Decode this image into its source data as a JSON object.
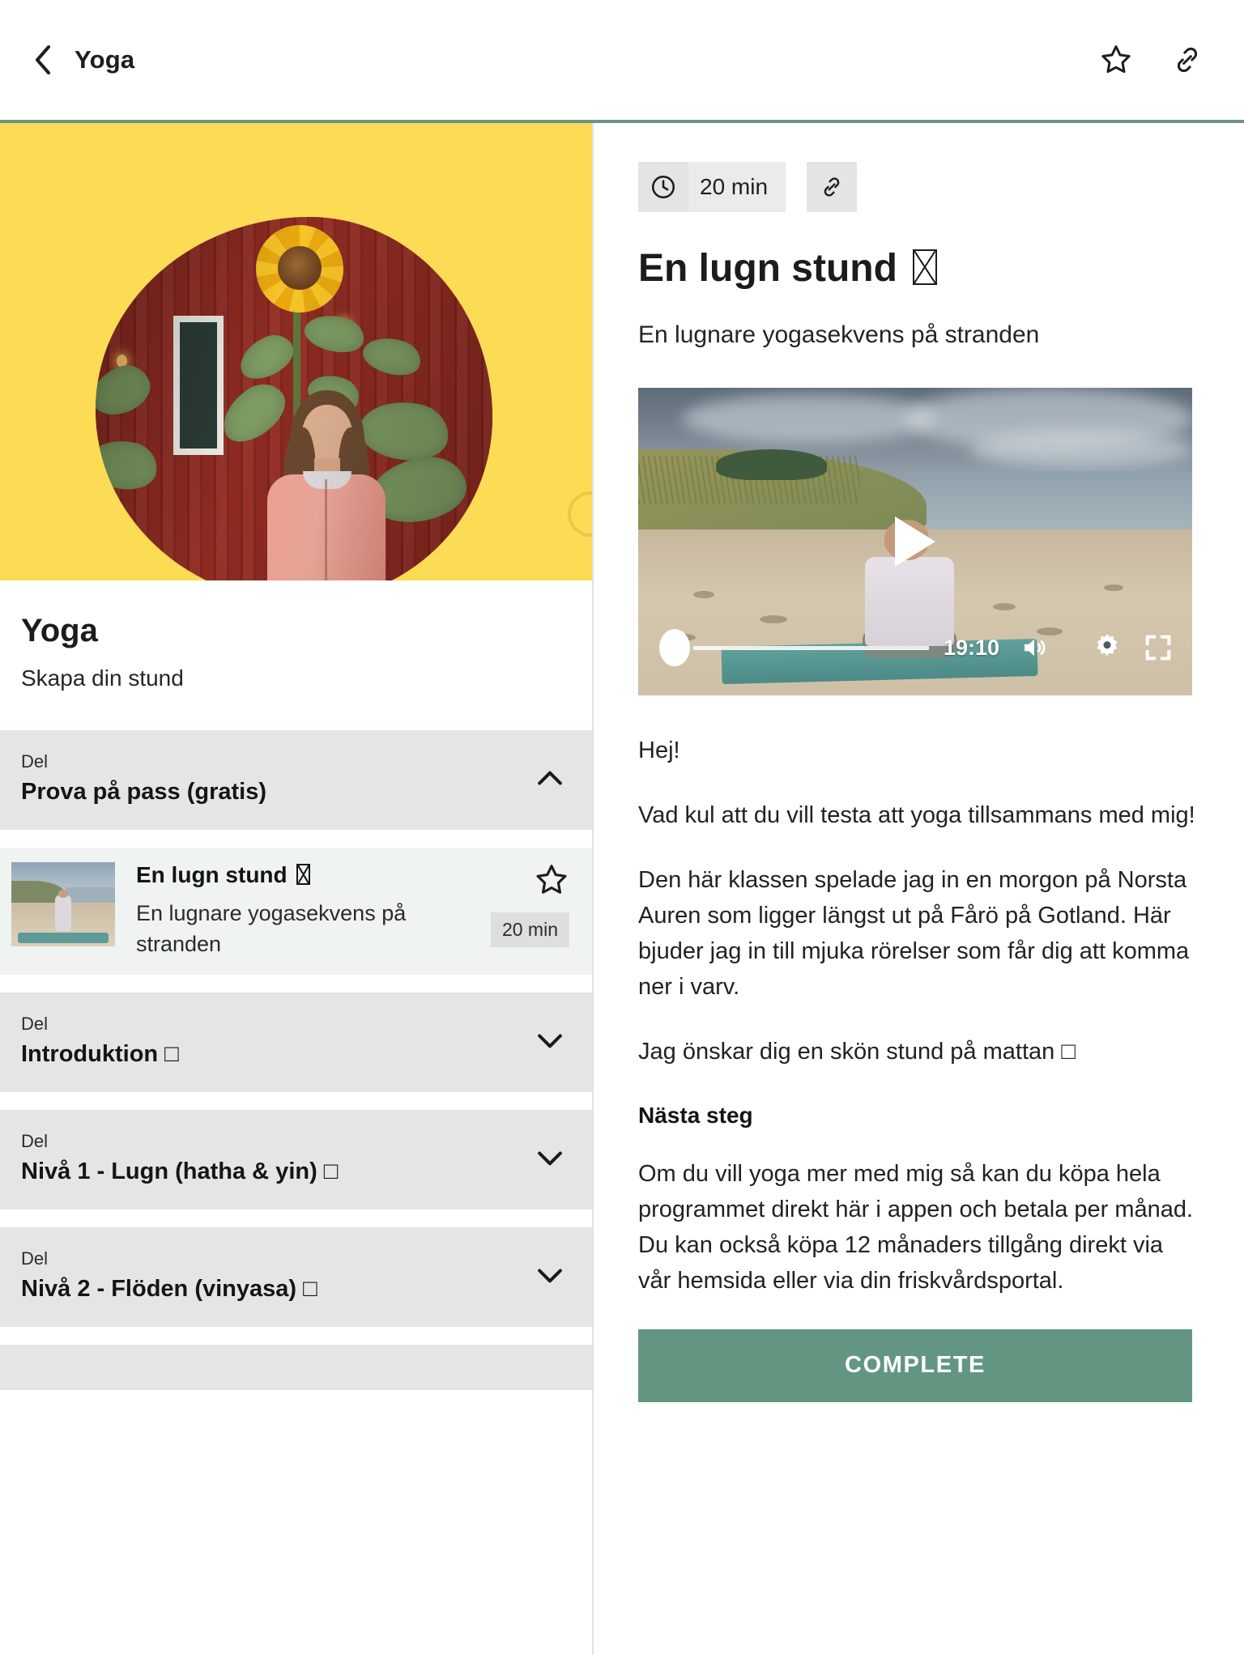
{
  "topbar": {
    "back_icon": "chevron-left-icon",
    "title": "Yoga",
    "favorite_icon": "star-outline-icon",
    "share_icon": "link-icon"
  },
  "sidebar": {
    "hero": {
      "background_color": "#fcdb55",
      "image_alt": "Woman in pink jacket by red barn with sunflower"
    },
    "course_title": "Yoga",
    "course_subtitle": "Skapa din stund",
    "section_kicker": "Del",
    "sections": [
      {
        "kicker": "Del",
        "name": "Prova på pass (gratis)",
        "expanded": true,
        "chevron": "chevron-up-icon"
      },
      {
        "kicker": "Del",
        "name": "Introduktion □",
        "expanded": false,
        "chevron": "chevron-down-icon"
      },
      {
        "kicker": "Del",
        "name": "Nivå 1 - Lugn (hatha & yin) □",
        "expanded": false,
        "chevron": "chevron-down-icon"
      },
      {
        "kicker": "Del",
        "name": "Nivå 2 - Flöden (vinyasa) □",
        "expanded": false,
        "chevron": "chevron-down-icon"
      }
    ],
    "lesson": {
      "title": "En lugn stund",
      "description": "En lugnare yogasekvens på stranden",
      "duration": "20 min",
      "star_icon": "star-outline-icon",
      "thumb_alt": "Beach yoga thumbnail"
    }
  },
  "detail": {
    "duration_badge": "20 min",
    "clock_icon": "clock-icon",
    "link_icon": "link-icon",
    "title": "En lugn stund",
    "subtitle": "En lugnare yogasekvens på stranden",
    "player": {
      "play_icon": "play-icon",
      "time": "19:10",
      "volume_icon": "volume-icon",
      "settings_icon": "gear-icon",
      "fullscreen_icon": "fullscreen-icon",
      "progress_percent": 0
    },
    "body": [
      "Hej!",
      "Vad kul att du vill testa att yoga tillsammans med mig!",
      "Den här klassen spelade jag in en morgon på Norsta Auren som ligger längst ut på Fårö på Gotland. Här bjuder jag in till mjuka rörelser som får dig att komma ner i varv.",
      "Jag önskar dig en skön stund på mattan □"
    ],
    "next_steps_heading": "Nästa steg",
    "next_steps_body": "Om du vill yoga mer med mig så kan du köpa hela programmet direkt här i appen och betala per månad. Du kan också köpa 12 månaders tillgång direkt via vår hemsida eller via din friskvårdsportal.",
    "cta_label": "COMPLETE",
    "cta_color": "#629680"
  }
}
